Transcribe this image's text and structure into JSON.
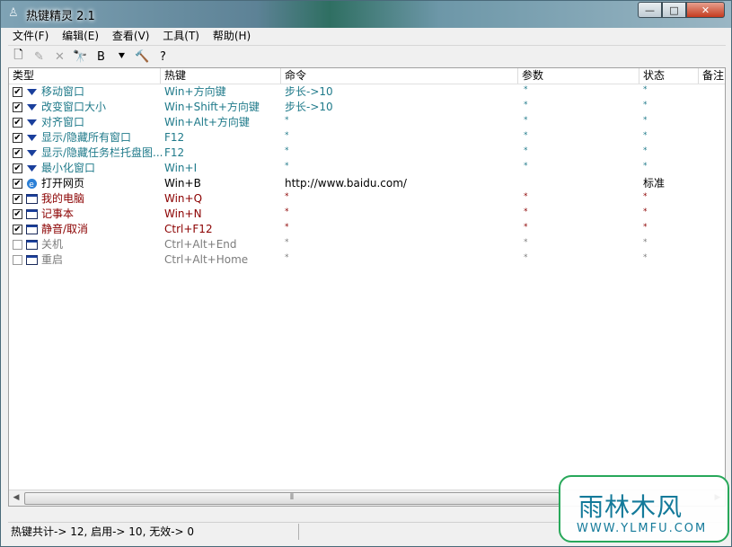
{
  "window": {
    "title": "热键精灵 2.1",
    "caption_buttons": {
      "minimize": "—",
      "maximize": "□",
      "close": "✕"
    }
  },
  "menu": [
    "文件(F)",
    "编辑(E)",
    "查看(V)",
    "工具(T)",
    "帮助(H)"
  ],
  "toolbar": [
    {
      "name": "new-icon",
      "glyph": "🗋",
      "enabled": true
    },
    {
      "name": "edit-icon",
      "glyph": "✎",
      "enabled": false
    },
    {
      "name": "delete-icon",
      "glyph": "✕",
      "enabled": false
    },
    {
      "name": "find-icon",
      "glyph": "🔭",
      "enabled": true
    },
    {
      "name": "bold-icon",
      "glyph": "B",
      "enabled": true
    },
    {
      "name": "arrow-down-icon",
      "glyph": "⯆",
      "enabled": true
    },
    {
      "name": "tools-icon",
      "glyph": "🔨",
      "enabled": true
    },
    {
      "name": "help-icon",
      "glyph": "?",
      "enabled": true
    }
  ],
  "columns": [
    "类型",
    "热键",
    "命令",
    "参数",
    "状态",
    "备注"
  ],
  "rows": [
    {
      "checked": true,
      "icon": "arrow-down-icon",
      "type": "移动窗口",
      "hotkey": "Win+方向键",
      "command": "步长->10",
      "param": "*",
      "status": "*",
      "color": "teal"
    },
    {
      "checked": true,
      "icon": "arrow-down-icon",
      "type": "改变窗口大小",
      "hotkey": "Win+Shift+方向键",
      "command": "步长->10",
      "param": "*",
      "status": "*",
      "color": "teal"
    },
    {
      "checked": true,
      "icon": "arrow-down-icon",
      "type": "对齐窗口",
      "hotkey": "Win+Alt+方向键",
      "command": "*",
      "param": "*",
      "status": "*",
      "color": "teal"
    },
    {
      "checked": true,
      "icon": "arrow-down-icon",
      "type": "显示/隐藏所有窗口",
      "hotkey": "F12",
      "command": "*",
      "param": "*",
      "status": "*",
      "color": "teal"
    },
    {
      "checked": true,
      "icon": "arrow-down-icon",
      "type": "显示/隐藏任务栏托盘图...",
      "hotkey": "F12",
      "command": "*",
      "param": "*",
      "status": "*",
      "color": "teal"
    },
    {
      "checked": true,
      "icon": "arrow-down-icon",
      "type": "最小化窗口",
      "hotkey": "Win+I",
      "command": "*",
      "param": "*",
      "status": "*",
      "color": "teal"
    },
    {
      "checked": true,
      "icon": "ie-icon",
      "type": "打开网页",
      "hotkey": "Win+B",
      "command": "http://www.baidu.com/",
      "param": "",
      "status": "标准",
      "color": "black"
    },
    {
      "checked": true,
      "icon": "window-icon",
      "type": "我的电脑",
      "hotkey": "Win+Q",
      "command": "*",
      "param": "*",
      "status": "*",
      "color": "red"
    },
    {
      "checked": true,
      "icon": "window-icon",
      "type": "记事本",
      "hotkey": "Win+N",
      "command": "*",
      "param": "*",
      "status": "*",
      "color": "red"
    },
    {
      "checked": true,
      "icon": "window-icon",
      "type": "静音/取消",
      "hotkey": "Ctrl+F12",
      "command": "*",
      "param": "*",
      "status": "*",
      "color": "red"
    },
    {
      "checked": false,
      "icon": "window-icon",
      "type": "关机",
      "hotkey": "Ctrl+Alt+End",
      "command": "*",
      "param": "*",
      "status": "*",
      "color": "gray"
    },
    {
      "checked": false,
      "icon": "window-icon",
      "type": "重启",
      "hotkey": "Ctrl+Alt+Home",
      "command": "*",
      "param": "*",
      "status": "*",
      "color": "gray"
    }
  ],
  "scrollbar": {
    "grip": "⦀"
  },
  "status": "热键共计-> 12, 启用-> 10, 无效-> 0",
  "watermark": {
    "cn": "雨林木风",
    "en": "WWW.YLMFU.COM"
  }
}
